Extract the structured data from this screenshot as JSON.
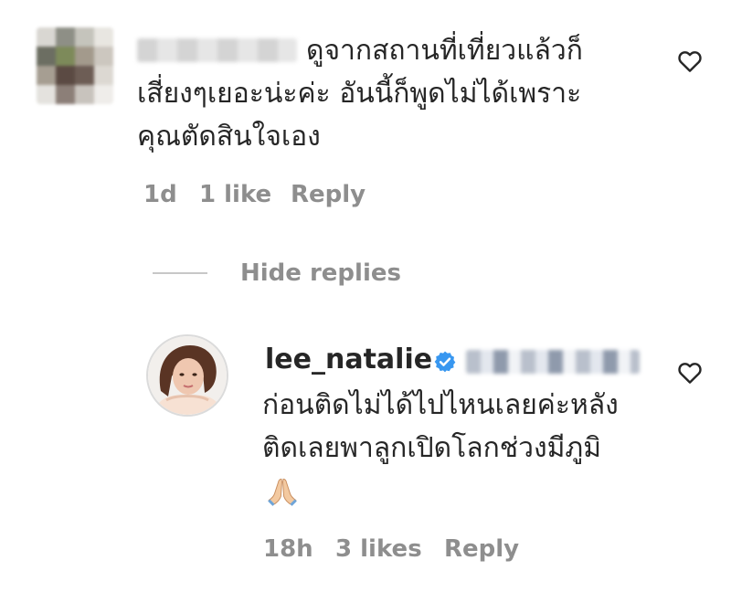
{
  "comment": {
    "avatar": "pixelated-avatar",
    "username": "",
    "text_lines": [
      "ดูจากสถานที่เที่ยวแล้วก็",
      "เสี่ยงๆเยอะน่ะค่ะ อันนี้ก็พูดไม่ได้เพราะ",
      "คุณตัดสินใจเอง"
    ],
    "time": "1d",
    "likes": "1 like",
    "reply_label": "Reply",
    "like_icon": "heart-outline-icon"
  },
  "replies_toggle": {
    "label": "Hide replies"
  },
  "reply": {
    "avatar": "profile-avatar",
    "username": "lee_natalie",
    "verified_icon": "verified-badge-icon",
    "text_lines": [
      "ก่อนติดไม่ได้ไปไหนเลยค่ะหลัง",
      "ติดเลยพาลูกเปิดโลกช่วงมีภูมิ"
    ],
    "emoji": "folded-hands-emoji",
    "time": "18h",
    "likes": "3 likes",
    "reply_label": "Reply",
    "like_icon": "heart-outline-icon"
  },
  "colors": {
    "text": "#262626",
    "meta": "#8e8e8e",
    "verified": "#3897f0",
    "divider": "#c7c7c7"
  }
}
